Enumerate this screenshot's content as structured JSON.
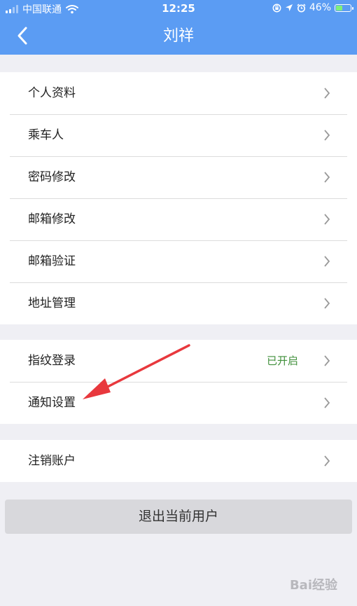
{
  "status_bar": {
    "carrier": "中国联通",
    "time": "12:25",
    "battery_percent": "46%",
    "battery_level": 0.46,
    "icons": [
      "signal-icon",
      "wifi-icon",
      "rotation-lock-icon",
      "location-icon",
      "alarm-icon",
      "battery-icon"
    ]
  },
  "header": {
    "title": "刘祥",
    "back_icon": "chevron-left-icon"
  },
  "group1": [
    {
      "label": "个人资料"
    },
    {
      "label": "乘车人"
    },
    {
      "label": "密码修改"
    },
    {
      "label": "邮箱修改"
    },
    {
      "label": "邮箱验证"
    },
    {
      "label": "地址管理"
    }
  ],
  "group2": [
    {
      "label": "指纹登录",
      "value": "已开启"
    },
    {
      "label": "通知设置"
    }
  ],
  "group3": [
    {
      "label": "注销账户"
    }
  ],
  "logout_label": "退出当前用户",
  "watermark": "Bai经验",
  "colors": {
    "header": "#5b9cf3",
    "background": "#efeff4",
    "value_green": "#3f8f3a",
    "annotation_arrow": "#e8383d"
  }
}
